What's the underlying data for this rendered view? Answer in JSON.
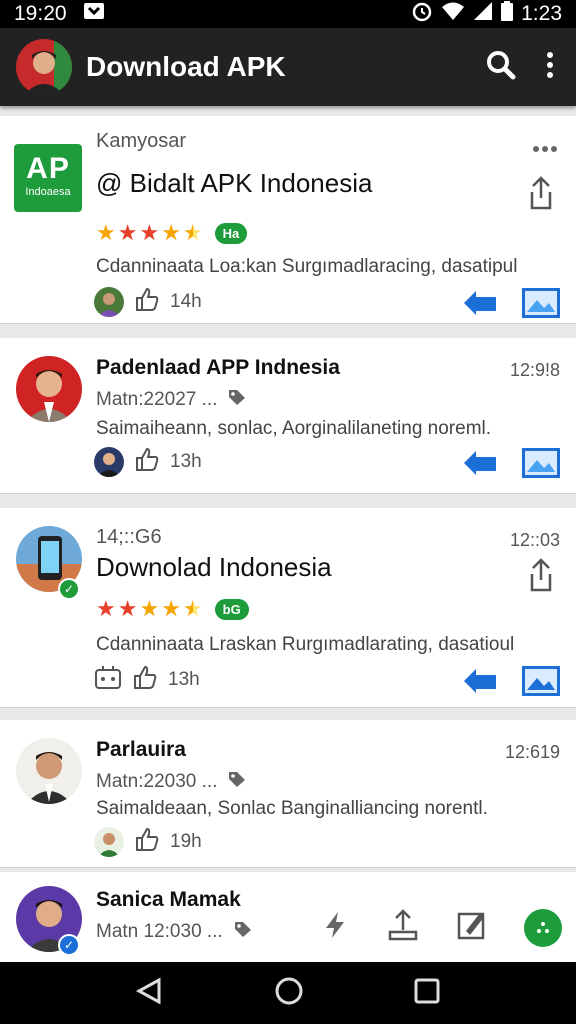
{
  "status_bar": {
    "time": "19:20",
    "clock": "1:23"
  },
  "app_bar": {
    "title": "Download APK"
  },
  "colors": {
    "accent_green": "#1e9b3b",
    "link_blue": "#1d6fd8",
    "app_bar": "#222222"
  },
  "cards": [
    {
      "app_icon_text": "AP",
      "app_icon_sub": "Indoaesa",
      "sender": "Kamyosar",
      "title": "@ Bidalt APK Indonesia",
      "rating_badge": "Ha",
      "desc": "Cdanninaata Loa:kan Surgımadlaracing, dasatipul",
      "likes": "14h"
    },
    {
      "name": "Padenlaad APP Indnesia",
      "time": "12:9!8",
      "sub": "Matn:22027 ...",
      "desc": "Saimaiheann, sonlac, Aorginalilaneting noreml.",
      "likes": "13h"
    },
    {
      "sender": "14;::G6",
      "time": "12::03",
      "title": "Downolad Indonesia",
      "rating_badge": "bG",
      "desc": "Cdanninaata Lraskan Rurgımadlarating, dasatioul",
      "likes": "13h"
    },
    {
      "name": "Parlauira",
      "time": "12:619",
      "sub": "Matn:22030 ...",
      "desc": "Saimaldeaan, Sonlac Banginalliancing norentl.",
      "likes": "19h"
    },
    {
      "name": "Sanica Mamak",
      "sub": "Matn 12:030 ..."
    }
  ]
}
